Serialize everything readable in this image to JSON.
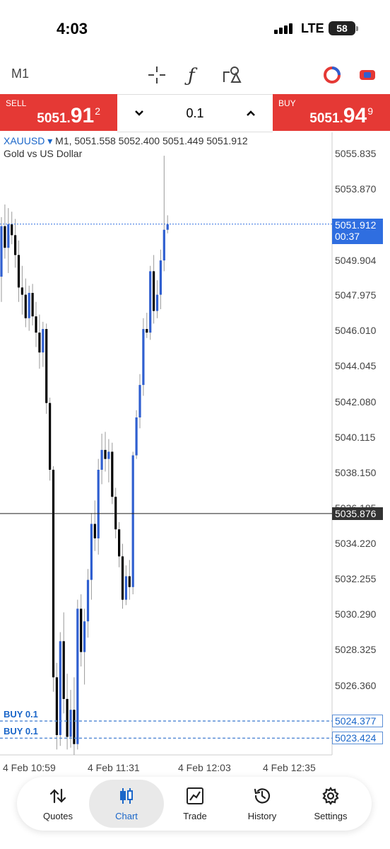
{
  "status_bar": {
    "time": "4:03",
    "network": "LTE",
    "battery": "58"
  },
  "toolbar": {
    "timeframe": "M1",
    "icons": [
      "crosshair-icon",
      "indicators-icon",
      "objects-icon",
      "one-click-trading-icon",
      "trade-mode-icon"
    ]
  },
  "trade_panel": {
    "sell": {
      "label": "SELL",
      "price_prefix": "5051.",
      "price_big": "91",
      "price_sup": "2"
    },
    "buy": {
      "label": "BUY",
      "price_prefix": "5051.",
      "price_big": "94",
      "price_sup": "9"
    },
    "volume": "0.1"
  },
  "chart": {
    "symbol": "XAUUSD",
    "ohlc_line": "M1, 5051.558 5052.400 5051.449 5051.912",
    "description": "Gold vs US Dollar",
    "current_price": "5051.912",
    "countdown": "00:37",
    "crosshair_price": "5035.876",
    "orders": [
      {
        "label": "BUY 0.1",
        "price": "5024.377"
      },
      {
        "label": "BUY 0.1",
        "price": "5023.424"
      }
    ],
    "y_tick_labels": [
      "5055.835",
      "5053.870",
      "5049.904",
      "5047.975",
      "5046.010",
      "5044.045",
      "5042.080",
      "5040.115",
      "5038.150",
      "5036.185",
      "5034.220",
      "5032.255",
      "5030.290",
      "5028.325",
      "5026.360"
    ],
    "x_tick_labels": [
      "4 Feb 10:59",
      "4 Feb 11:31",
      "4 Feb 12:03",
      "4 Feb 12:35"
    ],
    "colors": {
      "bull": "#2f5fd0",
      "bear": "#000000",
      "sell_bg": "#e53935",
      "accent": "#1a66c9"
    }
  },
  "chart_data": {
    "type": "candlestick",
    "symbol": "XAUUSD",
    "timeframe": "M1",
    "ylim": [
      5022.5,
      5057.0
    ],
    "y_ticks": [
      5055.835,
      5053.87,
      5051.905,
      5049.904,
      5047.975,
      5046.01,
      5044.045,
      5042.08,
      5040.115,
      5038.15,
      5036.185,
      5034.22,
      5032.255,
      5030.29,
      5028.325,
      5026.36,
      5024.395
    ],
    "current_price": 5051.912,
    "crosshair_price": 5035.876,
    "candles": [
      {
        "o": 5049.0,
        "h": 5052.3,
        "l": 5047.6,
        "c": 5051.8
      },
      {
        "o": 5051.8,
        "h": 5053.0,
        "l": 5050.0,
        "c": 5050.6
      },
      {
        "o": 5050.6,
        "h": 5052.8,
        "l": 5049.2,
        "c": 5051.9
      },
      {
        "o": 5051.9,
        "h": 5052.6,
        "l": 5050.8,
        "c": 5051.3
      },
      {
        "o": 5051.3,
        "h": 5052.2,
        "l": 5049.5,
        "c": 5050.2
      },
      {
        "o": 5050.2,
        "h": 5051.0,
        "l": 5047.6,
        "c": 5048.4
      },
      {
        "o": 5048.4,
        "h": 5049.6,
        "l": 5046.9,
        "c": 5048.0
      },
      {
        "o": 5048.0,
        "h": 5048.9,
        "l": 5046.2,
        "c": 5046.7
      },
      {
        "o": 5046.7,
        "h": 5048.5,
        "l": 5046.0,
        "c": 5048.1
      },
      {
        "o": 5048.1,
        "h": 5048.6,
        "l": 5046.3,
        "c": 5046.8
      },
      {
        "o": 5046.8,
        "h": 5047.6,
        "l": 5045.1,
        "c": 5045.9
      },
      {
        "o": 5045.9,
        "h": 5046.9,
        "l": 5043.9,
        "c": 5044.8
      },
      {
        "o": 5044.8,
        "h": 5046.5,
        "l": 5044.0,
        "c": 5046.1
      },
      {
        "o": 5046.1,
        "h": 5046.4,
        "l": 5041.4,
        "c": 5042.0
      },
      {
        "o": 5042.0,
        "h": 5042.3,
        "l": 5037.7,
        "c": 5038.3
      },
      {
        "o": 5038.3,
        "h": 5038.5,
        "l": 5026.0,
        "c": 5026.8
      },
      {
        "o": 5026.8,
        "h": 5027.6,
        "l": 5022.8,
        "c": 5023.6
      },
      {
        "o": 5023.6,
        "h": 5029.3,
        "l": 5023.0,
        "c": 5028.8
      },
      {
        "o": 5028.8,
        "h": 5030.4,
        "l": 5024.8,
        "c": 5025.6
      },
      {
        "o": 5025.6,
        "h": 5027.0,
        "l": 5022.8,
        "c": 5023.5
      },
      {
        "o": 5023.5,
        "h": 5026.1,
        "l": 5022.9,
        "c": 5025.0
      },
      {
        "o": 5025.0,
        "h": 5026.8,
        "l": 5022.5,
        "c": 5023.1
      },
      {
        "o": 5023.1,
        "h": 5031.1,
        "l": 5022.8,
        "c": 5030.6
      },
      {
        "o": 5030.6,
        "h": 5031.4,
        "l": 5027.4,
        "c": 5028.2
      },
      {
        "o": 5028.2,
        "h": 5030.6,
        "l": 5026.4,
        "c": 5029.9
      },
      {
        "o": 5029.9,
        "h": 5032.8,
        "l": 5029.0,
        "c": 5032.2
      },
      {
        "o": 5032.2,
        "h": 5035.9,
        "l": 5031.1,
        "c": 5035.3
      },
      {
        "o": 5035.3,
        "h": 5036.6,
        "l": 5033.8,
        "c": 5034.5
      },
      {
        "o": 5034.5,
        "h": 5038.9,
        "l": 5033.6,
        "c": 5038.3
      },
      {
        "o": 5038.3,
        "h": 5040.3,
        "l": 5037.5,
        "c": 5039.4
      },
      {
        "o": 5039.4,
        "h": 5040.4,
        "l": 5038.2,
        "c": 5038.9
      },
      {
        "o": 5038.9,
        "h": 5040.0,
        "l": 5037.6,
        "c": 5039.3
      },
      {
        "o": 5039.3,
        "h": 5039.8,
        "l": 5036.4,
        "c": 5036.8
      },
      {
        "o": 5036.8,
        "h": 5037.3,
        "l": 5034.5,
        "c": 5035.0
      },
      {
        "o": 5035.0,
        "h": 5035.4,
        "l": 5032.9,
        "c": 5033.5
      },
      {
        "o": 5033.5,
        "h": 5034.2,
        "l": 5030.6,
        "c": 5031.1
      },
      {
        "o": 5031.1,
        "h": 5033.0,
        "l": 5030.8,
        "c": 5032.4
      },
      {
        "o": 5032.4,
        "h": 5033.3,
        "l": 5031.1,
        "c": 5031.8
      },
      {
        "o": 5031.8,
        "h": 5039.3,
        "l": 5031.4,
        "c": 5039.1
      },
      {
        "o": 5039.1,
        "h": 5041.6,
        "l": 5038.9,
        "c": 5041.2
      },
      {
        "o": 5041.2,
        "h": 5043.6,
        "l": 5040.6,
        "c": 5043.0
      },
      {
        "o": 5043.0,
        "h": 5046.7,
        "l": 5042.4,
        "c": 5046.1
      },
      {
        "o": 5046.1,
        "h": 5047.0,
        "l": 5045.6,
        "c": 5045.9
      },
      {
        "o": 5045.9,
        "h": 5049.6,
        "l": 5045.5,
        "c": 5049.3
      },
      {
        "o": 5049.3,
        "h": 5050.2,
        "l": 5046.4,
        "c": 5047.1
      },
      {
        "o": 5047.1,
        "h": 5048.8,
        "l": 5046.7,
        "c": 5048.0
      },
      {
        "o": 5048.0,
        "h": 5050.5,
        "l": 5047.2,
        "c": 5049.9
      },
      {
        "o": 5049.9,
        "h": 5055.7,
        "l": 5049.3,
        "c": 5051.6
      },
      {
        "o": 5051.6,
        "h": 5052.4,
        "l": 5051.4,
        "c": 5051.9
      }
    ],
    "orders": [
      {
        "side": "BUY",
        "volume": 0.1,
        "price": 5024.377
      },
      {
        "side": "BUY",
        "volume": 0.1,
        "price": 5023.424
      }
    ]
  },
  "nav": {
    "items": [
      {
        "label": "Quotes",
        "icon": "quotes-arrows-icon"
      },
      {
        "label": "Chart",
        "icon": "chart-candles-icon"
      },
      {
        "label": "Trade",
        "icon": "trade-line-icon"
      },
      {
        "label": "History",
        "icon": "history-clock-icon"
      },
      {
        "label": "Settings",
        "icon": "settings-gear-icon"
      }
    ]
  }
}
